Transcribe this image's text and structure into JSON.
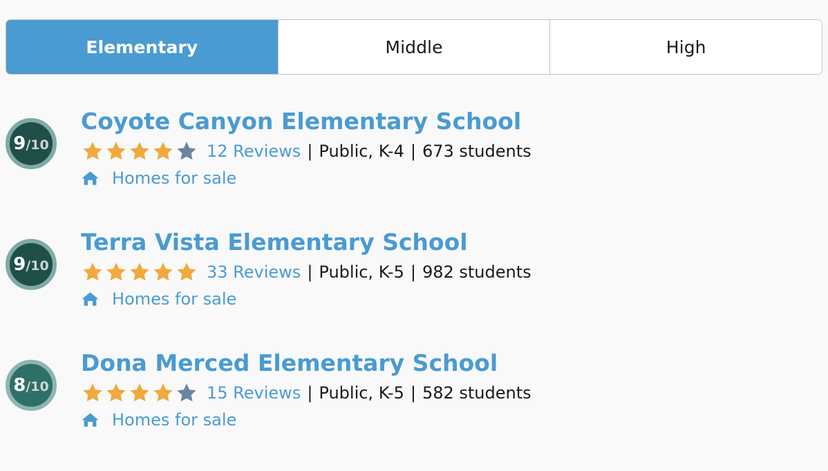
{
  "theme": {
    "background": "#f9f9fa",
    "accent_blue": "#4a9bd1",
    "star_gold": "#f0a93c",
    "star_gray": "#6b84a0",
    "text_dark": "#1a1a1a",
    "border": "#c3c3c3"
  },
  "tabs": {
    "items": [
      {
        "label": "Elementary",
        "active": true
      },
      {
        "label": "Middle",
        "active": false
      },
      {
        "label": "High",
        "active": false
      }
    ]
  },
  "schools": [
    {
      "rating_score": "9",
      "rating_outof": "/10",
      "badge_color": "#1f4f48",
      "badge_ring": "#80aaa5",
      "name": "Coyote Canyon Elementary School",
      "stars_filled": 4,
      "stars_total": 5,
      "reviews": "12 Reviews",
      "separator": "|",
      "type_grades": "Public, K-4",
      "students": "673 students",
      "homes_link": "Homes for sale",
      "homes_icon": "home-icon"
    },
    {
      "rating_score": "9",
      "rating_outof": "/10",
      "badge_color": "#1f4f48",
      "badge_ring": "#80aaa5",
      "name": "Terra Vista Elementary School",
      "stars_filled": 5,
      "stars_total": 5,
      "reviews": "33 Reviews",
      "separator": "|",
      "type_grades": "Public, K-5",
      "students": "982 students",
      "homes_link": "Homes for sale",
      "homes_icon": "home-icon"
    },
    {
      "rating_score": "8",
      "rating_outof": "/10",
      "badge_color": "#2e7068",
      "badge_ring": "#8fb5b0",
      "name": "Dona Merced Elementary School",
      "stars_filled": 4,
      "stars_total": 5,
      "reviews": "15 Reviews",
      "separator": "|",
      "type_grades": "Public, K-5",
      "students": "582 students",
      "homes_link": "Homes for sale",
      "homes_icon": "home-icon"
    }
  ]
}
